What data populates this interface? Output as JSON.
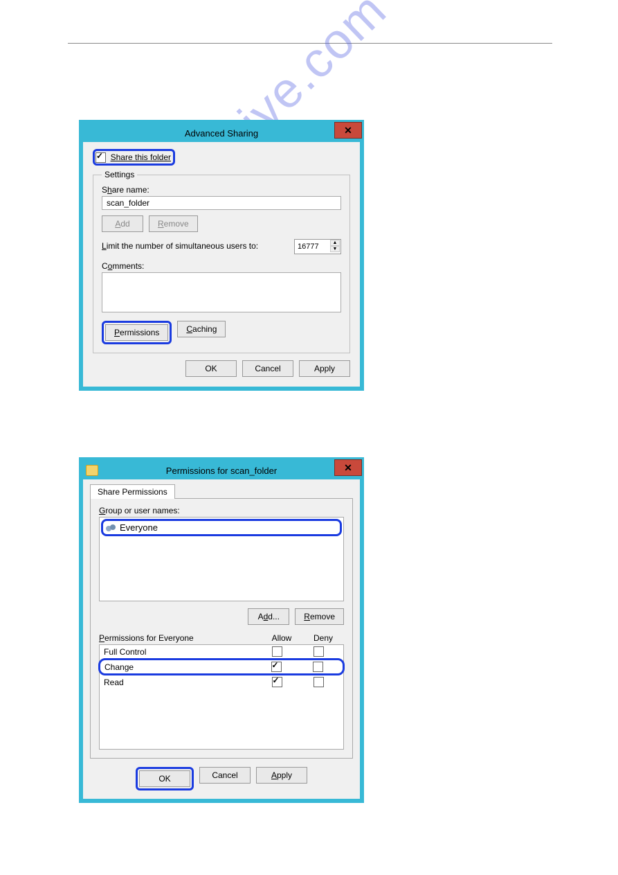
{
  "watermark": "manualshive.com",
  "dialog1": {
    "title": "Advanced Sharing",
    "share_checkbox_label": "Share this folder",
    "settings_legend": "Settings",
    "share_name_label": "Share name:",
    "share_name_value": "scan_folder",
    "add_btn": "Add",
    "remove_btn": "Remove",
    "limit_label": "Limit the number of simultaneous users to:",
    "limit_value": "16777",
    "comments_label": "Comments:",
    "permissions_btn": "Permissions",
    "caching_btn": "Caching",
    "ok_btn": "OK",
    "cancel_btn": "Cancel",
    "apply_btn": "Apply"
  },
  "dialog2": {
    "title": "Permissions for scan_folder",
    "tab_label": "Share Permissions",
    "group_label": "Group or user names:",
    "user_name": "Everyone",
    "add_btn": "Add...",
    "remove_btn": "Remove",
    "perm_for_label": "Permissions for Everyone",
    "allow_header": "Allow",
    "deny_header": "Deny",
    "perm_full": "Full Control",
    "perm_change": "Change",
    "perm_read": "Read",
    "ok_btn": "OK",
    "cancel_btn": "Cancel",
    "apply_btn": "Apply"
  }
}
